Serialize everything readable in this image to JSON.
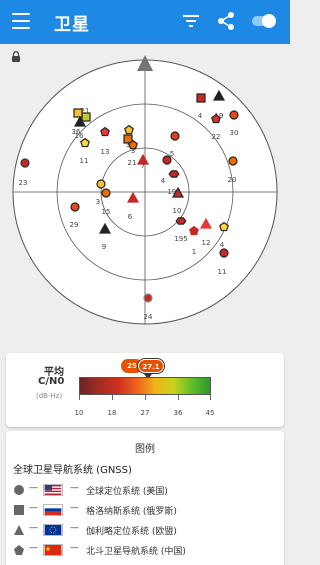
{
  "app_bar": {
    "title": "卫星",
    "background": "#1e88e5"
  },
  "sky_view": {
    "north_marker_color": "#757575",
    "satellites": [
      {
        "id": "23",
        "shape": "circle",
        "color": "#c62828",
        "border": "#333"
      },
      {
        "id": "21",
        "shape": "square",
        "color": "#c0ca33",
        "border": "#222"
      },
      {
        "id": "36",
        "shape": "square",
        "color": "#fbc02d",
        "border": "#222"
      },
      {
        "id": "16",
        "shape": "triangle",
        "color": "#222",
        "border": "#222"
      },
      {
        "id": "11",
        "shape": "pentagon",
        "color": "#fdd835",
        "border": "#222"
      },
      {
        "id": "13",
        "shape": "pentagon",
        "color": "#e53935",
        "border": "#222"
      },
      {
        "id": "21",
        "shape": "pentagon",
        "color": "#fbc02d",
        "border": "#222"
      },
      {
        "id": "3",
        "shape": "square",
        "color": "#ef6c00",
        "border": "#222"
      },
      {
        "id": "3",
        "shape": "pentagon",
        "color": "#ef6c00",
        "border": "#222"
      },
      {
        "id": "7",
        "shape": "triangle",
        "color": "#c62828",
        "border": "#c62828"
      },
      {
        "id": "5",
        "shape": "circle",
        "color": "#d84315",
        "border": "#222"
      },
      {
        "id": "4",
        "shape": "square",
        "color": "#c62828",
        "border": "#222"
      },
      {
        "id": "19",
        "shape": "triangle",
        "color": "#222",
        "border": "#222"
      },
      {
        "id": "22",
        "shape": "pentagon",
        "color": "#d32f2f",
        "border": "#222"
      },
      {
        "id": "30",
        "shape": "circle",
        "color": "#e64a19",
        "border": "#222"
      },
      {
        "id": "4",
        "shape": "circle",
        "color": "#c62828",
        "border": "#222"
      },
      {
        "id": "196",
        "shape": "hexagon",
        "color": "#c62828",
        "border": "#222"
      },
      {
        "id": "20",
        "shape": "circle",
        "color": "#ef6c00",
        "border": "#222"
      },
      {
        "id": "29",
        "shape": "circle",
        "color": "#e64a19",
        "border": "#222"
      },
      {
        "id": "3",
        "shape": "circle",
        "color": "#fbc02d",
        "border": "#222"
      },
      {
        "id": "15",
        "shape": "circle",
        "color": "#ef6c00",
        "border": "#222"
      },
      {
        "id": "6",
        "shape": "triangle",
        "color": "#c62828",
        "border": "#c62828"
      },
      {
        "id": "10",
        "shape": "triangle",
        "color": "#c62828",
        "border": "#222"
      },
      {
        "id": "195",
        "shape": "hexagon",
        "color": "#c62828",
        "border": "#222"
      },
      {
        "id": "12",
        "shape": "triangle",
        "color": "#e53935",
        "border": "#e53935"
      },
      {
        "id": "1",
        "shape": "pentagon",
        "color": "#c62828",
        "border": "#c62828"
      },
      {
        "id": "4",
        "shape": "pentagon",
        "color": "#fdd835",
        "border": "#222"
      },
      {
        "id": "11",
        "shape": "circle",
        "color": "#c62828",
        "border": "#222"
      },
      {
        "id": "9",
        "shape": "triangle",
        "color": "#222",
        "border": "#222"
      },
      {
        "id": "24",
        "shape": "circle",
        "color": "#c62828",
        "border": "#888"
      }
    ]
  },
  "cn0": {
    "label_line1": "平均",
    "label_line2": "C/N0",
    "label_unit": "(dB-Hz)",
    "avg_a": "25",
    "avg_b": "27.1",
    "ticks": [
      "10",
      "18",
      "27",
      "36",
      "45"
    ]
  },
  "legend": {
    "title": "图例",
    "section": "全球卫星导航系统 (GNSS)",
    "dash": "—",
    "rows": [
      {
        "shape": "circle",
        "name": "全球定位系统 (美国)"
      },
      {
        "shape": "square",
        "name": "格洛纳斯系统 (俄罗斯)"
      },
      {
        "shape": "triangle",
        "name": "伽利略定位系统 (欧盟)"
      },
      {
        "shape": "pentagon",
        "name": "北斗卫星导航系统 (中国)"
      }
    ]
  }
}
